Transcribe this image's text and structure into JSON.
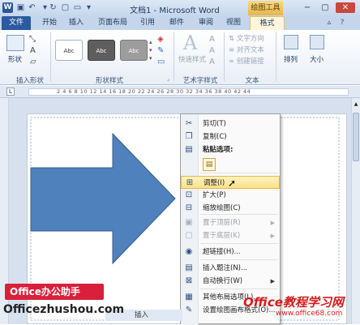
{
  "app": {
    "title": "文档1 - Microsoft Word",
    "context_tab_group": "绘图工具"
  },
  "tabs": [
    "文件",
    "开始",
    "插入",
    "页面布局",
    "引用",
    "邮件",
    "审阅",
    "视图",
    "格式"
  ],
  "ribbon": {
    "insert_shapes": {
      "label": "插入形状",
      "shape_button": "形状"
    },
    "shape_styles": {
      "label": "形状样式",
      "style_preview": "Abc"
    },
    "art_styles": {
      "label": "艺术字样式",
      "quick_styles": "快速样式"
    },
    "text": {
      "label": "文本",
      "direction": "文字方向",
      "align": "对齐文本",
      "link": "创建链接"
    },
    "arrange": {
      "label": "排列"
    },
    "size": {
      "label": "大小"
    }
  },
  "ruler": {
    "numbers": "2 4 6 8 10 12 14 16 18 20 22 24 26 28 30 32 34 36 38 40 42 44"
  },
  "shape": {
    "fill": "#4f81bd",
    "stroke": "#385d8a"
  },
  "context_menu": {
    "items": [
      {
        "label": "剪切(T)",
        "icon": "scissors-icon",
        "enabled": true
      },
      {
        "label": "复制(C)",
        "icon": "copy-icon",
        "enabled": true
      },
      {
        "label": "粘贴选项:",
        "icon": "paste-icon",
        "enabled": true,
        "bold": true
      },
      {
        "label": "调整(I)",
        "icon": "adjust-icon",
        "enabled": true,
        "highlighted": true
      },
      {
        "label": "扩大(P)",
        "icon": "expand-icon",
        "enabled": true
      },
      {
        "label": "缩放绘图(C)",
        "icon": "scale-drawing-icon",
        "enabled": true
      },
      {
        "label": "置于顶层(R)",
        "icon": "bring-to-front-icon",
        "enabled": false,
        "submenu": true
      },
      {
        "label": "置于底层(K)",
        "icon": "send-to-back-icon",
        "enabled": false,
        "submenu": true
      },
      {
        "label": "超链接(H)...",
        "icon": "hyperlink-icon",
        "enabled": true
      },
      {
        "label": "插入题注(N)...",
        "icon": "caption-icon",
        "enabled": true
      },
      {
        "label": "自动换行(W)",
        "icon": "wrap-text-icon",
        "enabled": true,
        "submenu": true
      },
      {
        "label": "其他布局选项(L)...",
        "icon": "layout-options-icon",
        "enabled": true
      },
      {
        "label": "设置绘图画布格式(O)...",
        "icon": "format-canvas-icon",
        "enabled": true
      }
    ]
  },
  "watermarks": {
    "office_helper": "Office办公助手",
    "office_helper_url": "Officezhushou.com",
    "jiaocheng": "Office教程学习网",
    "jiaocheng_url": "www.office68.com"
  },
  "statusbar": {
    "text": "插入"
  }
}
